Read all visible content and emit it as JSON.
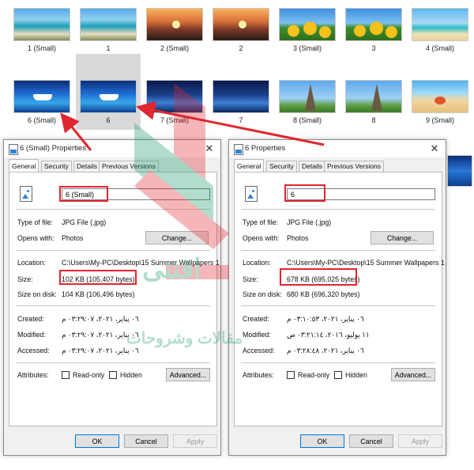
{
  "thumbnails": [
    {
      "label": "1 (Small)",
      "image": "beach"
    },
    {
      "label": "1",
      "image": "beach"
    },
    {
      "label": "2 (Small)",
      "image": "sunset"
    },
    {
      "label": "2",
      "image": "sunset"
    },
    {
      "label": "3 (Small)",
      "image": "sunflower"
    },
    {
      "label": "3",
      "image": "sunflower"
    },
    {
      "label": "4 (Small)",
      "image": "palm"
    },
    {
      "label": "6 (Small)",
      "image": "yacht"
    },
    {
      "label": "6",
      "image": "yacht"
    },
    {
      "label": "7 (Small)",
      "image": "night"
    },
    {
      "label": "7",
      "image": "night"
    },
    {
      "label": "8 (Small)",
      "image": "paris"
    },
    {
      "label": "8",
      "image": "paris"
    },
    {
      "label": "9 (Small)",
      "image": "shells"
    }
  ],
  "dialog_left": {
    "title": "6 (Small) Properties",
    "tabs": [
      "General",
      "Security",
      "Details",
      "Previous Versions"
    ],
    "file_name": "6 (Small)",
    "labels": {
      "type": "Type of file:",
      "opens": "Opens with:",
      "location": "Location:",
      "size": "Size:",
      "size_on_disk": "Size on disk:",
      "created": "Created:",
      "modified": "Modified:",
      "accessed": "Accessed:",
      "attributes": "Attributes:"
    },
    "type_value": "JPG File (.jpg)",
    "opens_value": "Photos",
    "change_button": "Change...",
    "location_value": "C:\\Users\\My-PC\\Desktop\\15 Summer Wallpapers 1",
    "size_value": "102 KB (105,407 bytes)",
    "size_on_disk_value": "104 KB (106,496 bytes)",
    "created_value": "٠٦ يناير، ٢٠٢١، ٠٣:٢٩:٠٧ م",
    "modified_value": "٠٦ يناير، ٢٠٢١، ٠٣:٢٩:٠٧ م",
    "accessed_value": "٠٦ يناير، ٢٠٢١، ٠٣:٢٩:٠٧ م",
    "readonly": "Read-only",
    "hidden": "Hidden",
    "advanced_button": "Advanced...",
    "ok": "OK",
    "cancel": "Cancel",
    "apply": "Apply"
  },
  "dialog_right": {
    "title": "6 Properties",
    "tabs": [
      "General",
      "Security",
      "Details",
      "Previous Versions"
    ],
    "file_name": "6",
    "labels": {
      "type": "Type of file:",
      "opens": "Opens with:",
      "location": "Location:",
      "size": "Size:",
      "size_on_disk": "Size on disk:",
      "created": "Created:",
      "modified": "Modified:",
      "accessed": "Accessed:",
      "attributes": "Attributes:"
    },
    "type_value": "JPG File (.jpg)",
    "opens_value": "Photos",
    "change_button": "Change...",
    "location_value": "C:\\Users\\My-PC\\Desktop\\15 Summer Wallpapers 1",
    "size_value": "678 KB (695,025 bytes)",
    "size_on_disk_value": "680 KB (696,320 bytes)",
    "created_value": "٠٦ يناير، ٢٠٢١، ٠٣:١٠:٥٣ م",
    "modified_value": "١١ يوليو، ٢٠١٦، ٠٣:٢١:١٤ ص",
    "accessed_value": "٠٦ يناير، ٢٠٢١، ٠٣:٢٨:٤٨ م",
    "readonly": "Read-only",
    "hidden": "Hidden",
    "advanced_button": "Advanced...",
    "ok": "OK",
    "cancel": "Cancel",
    "apply": "Apply"
  },
  "watermark": {
    "brand": "اقتنى",
    "tagline": "مقالات وشروحات"
  },
  "colors": {
    "highlight": "#e0262f",
    "watermark_green": "#1a9a6a",
    "watermark_red": "#e0262f"
  }
}
